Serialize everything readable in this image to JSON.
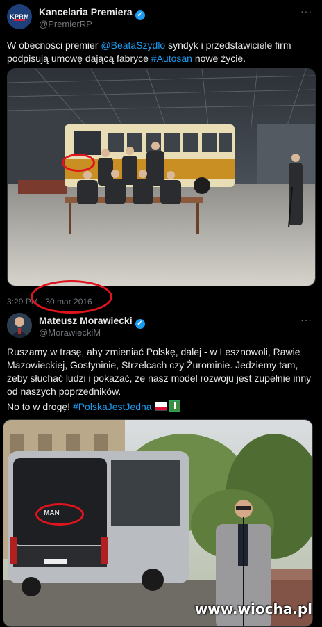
{
  "tweet1": {
    "avatar_text": "KPRM",
    "name": "Kancelaria Premiera",
    "handle": "@PremierRP",
    "text_before": "W obecności premier ",
    "mention": "@BeataSzydlo",
    "text_middle": " syndyk i przedstawiciele firm podpisują umowę dającą fabryce ",
    "hashtag": "#Autosan",
    "text_after": " nowe życie.",
    "time": "3:29 PM · 30 mar 2016"
  },
  "tweet2": {
    "name": "Mateusz Morawiecki",
    "handle": "@MorawieckiM",
    "paragraph1": "Ruszamy w trasę, aby zmieniać Polskę, dalej - w Lesznowoli, Rawie Mazowieckiej, Gostyninie, Strzelcach czy Żurominie. Jedziemy tam, żeby słuchać ludzi i pokazać, że nasz model rozwoju jest zupełnie inny od naszych poprzedników.",
    "paragraph2_text": "No to w drogę! ",
    "paragraph2_hashtag": "#PolskaJestJedna"
  },
  "bus_logo": "MAN",
  "watermark": "www.wiocha.pl",
  "icons": [
    "verified-badge-icon",
    "more-icon",
    "poland-flag-icon",
    "road-icon"
  ],
  "colors": {
    "link": "#1d9bf0",
    "annotation": "#e0141e",
    "background": "#000000"
  }
}
